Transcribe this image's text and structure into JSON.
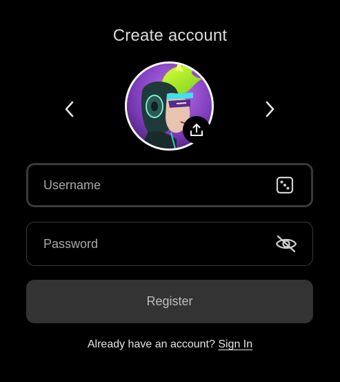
{
  "header": {
    "title": "Create account"
  },
  "avatar_picker": {
    "prev_icon": "chevron-left-icon",
    "next_icon": "chevron-right-icon",
    "upload_icon": "upload-icon"
  },
  "form": {
    "username": {
      "placeholder": "Username",
      "value": "",
      "icon": "dice-icon"
    },
    "password": {
      "placeholder": "Password",
      "value": "",
      "icon": "eye-off-icon"
    },
    "register_label": "Register"
  },
  "footer": {
    "prompt": "Already have an account?",
    "link_label": "Sign In"
  },
  "colors": {
    "background": "#000000",
    "field_border": "#3a3a3a",
    "button_bg": "#333333",
    "text": "#e6e6e6",
    "placeholder": "#a9a9a9"
  }
}
